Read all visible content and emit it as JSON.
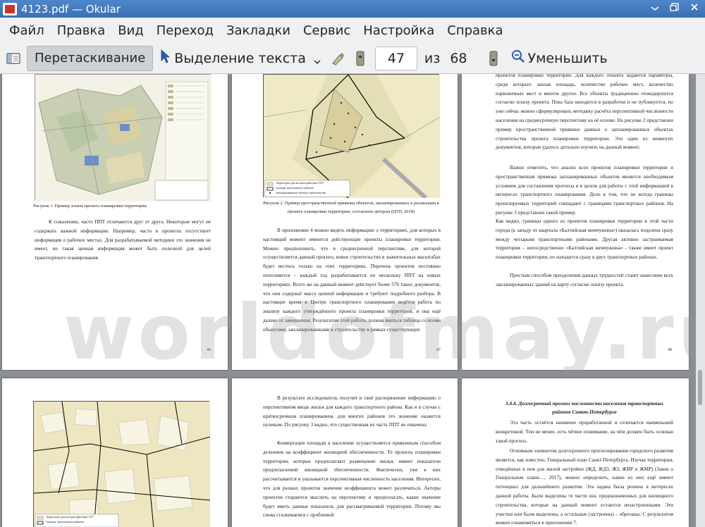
{
  "window": {
    "title": "4123.pdf  — Okular"
  },
  "menu": [
    "Файл",
    "Правка",
    "Вид",
    "Переход",
    "Закладки",
    "Сервис",
    "Настройка",
    "Справка"
  ],
  "toolbar": {
    "drag_label": "Перетаскивание",
    "select_label": "Выделение текста",
    "page_current": "47",
    "of_label": "из",
    "page_total": "68",
    "zoom_out_label": "Уменьшить"
  },
  "pages": {
    "p46": {
      "caption": "Рисунок 1. Пример эскиза проекта планировки территории.",
      "text": "К сожалению, часто ППТ отличаются друг от друга. Некоторые могут не содержать важной информации. Например, часто в проектах отсутствует информация о рабочих местах. Для разрабатываемой методики это значения не имеет, но такая ценная информация может быть полезной для целей транспортного планирования.",
      "number": "46"
    },
    "p47": {
      "legend": [
        "Территория, для которых действует ППТ",
        "Границы транспортных районов",
        "Запланированные объекты строительства"
      ],
      "caption": "Рисунок 2. Пример пространственной привязки объектов, запланированных к реализации в проекте планировки территории, составлено автором (ЦТП, 2018)",
      "text": "В приложении 4 можно видеть информацию о территориях, для которых в настоящий момент имеются действующие проекты планировки территории. Можно предположить, что в среднесрочной перспективе, для которой осуществляется данный прогноз, новое строительство в значительных масштабах будет вестись только на этих территориях. Перечень проектов постоянно пополняется – каждый год разрабатывается по нескольку ППТ на новых территориях. Всего же на данный момент действует более 570 таких документов, что они содержат массу ценной информации и требуют подробного разбора. В настоящее время в Центре транспортного планирования ведётся работа по анализу каждого утверждённого проекта планировки территорий, и она ещё далеко от завершения. Результатом этой работы должна явиться таблица со всеми объектами, запланированными к строительству в рамках существующих",
      "number": "47"
    },
    "p48": {
      "text1": "проектов планировки территории. Для каждого объекта задаются параметры, среди которых: жилая площадь, количество рабочих мест, количество парковочных мест и многое другое. Все объекты традиционно геокодируются согласно эскизу проекта. Пока база находится в разработке и не публикуется, но уже сейчас можно сформулировать методику расчёта перспективной численности населения на среднесрочную перспективу на её основе. На рисунке 2 представлен пример пространственной привязки данных о запланированных объектах строительства проекта планировки территории. Это один из немногих документов, которые удалось детально изучить на данный момент.",
      "text2": "Важно отметить, что анализ всех проектов планировки территории и пространственная привязка запланированных объектов является необходимым условием для составления прогноза и в целом для работы с этой информацией в интересах транспортного планирования. Дело в том, что не всегда границы проектируемых территорий совпадают с границами транспортных районов. На рисунке 3 представлен такой пример.",
      "text3": "Как видно, границы одного из проектов планировки территории в этой части города (к западу от квартала «Балтийская жемчужина») оказалась поделена сразу между четырьмя транспортными районами. Другая активно застраиваемая территория – непосредственно «Балтийская жемчужина» - также имеет проект планировки территории, но находится сразу в двух транспортных районах.",
      "text4": "Простым способом преодоления данных трудностей станет нанесение всех запланированных зданий на карту согласно эскизу проекта.",
      "number": "48"
    },
    "p49": {
      "legend": [
        "Территория, для которых действует ППТ",
        "Границы транспортных районов"
      ]
    },
    "p50": {
      "text": "В результате исследователь получит в своё распоряжение информацию о перспективном вводе жилья для каждого транспортного района. Как и в случае с краткосрочным планированием, для многих районов это значение окажется нулевым. По рисунку 3 видно, что существенная их часть ППТ не охвачена.",
      "text2": "Конвертация площади в население осуществляется привычным способом делением на коэффициент жилищной обеспеченности. Те проекты планировки территории, которые предполагают размещение жилья, имеют показатели предполагаемой жилищной обеспеченности. Фактически, уже в них рассчитывается и указывается перспективная численность населения. Интересно, что для разных проектов значение коэффициента может различаться. Акторы проектов стараются мыслить на перспективу и предполагать, какие значение будет иметь данные показатель для рассматриваемой территории. Потому мы снова сталкиваемся с проблемой"
    },
    "p51": {
      "heading": "3.4.4. Долгосрочный прогноз численности населения транспортных районов Санкт-Петербурга",
      "text1": "Эта часть остаётся наименее проработанной и отличается наименьшей конкретикой. Тем не менее, есть чёткое понимание, на чём должен быть основан такой прогноз.",
      "text2": "Основным элементом долгосрочного прогнозирования городского развития является, как известно, Генеральный план Санкт-Петербурга. Изучая территории, отведённые в нем для жилой застройки (ЖД, ЖД3, ЖЗ, ЖИР и ЖМР) (Закон о Генеральном плане…, 2017), можно определить, какие из них ещё имеют потенциал для дальнейшего развития. Эта задача была решена в интересах данной работы. Были выделены те части зон, предназначенных для жилищного строительства, которые на данный момент остаются незастроенными. Эти участки или были выделены, а остальные (застроены) – обрезаны. С результатом можно ознакомиться в приложении 7."
    }
  },
  "watermark": "worldofmay.ru"
}
